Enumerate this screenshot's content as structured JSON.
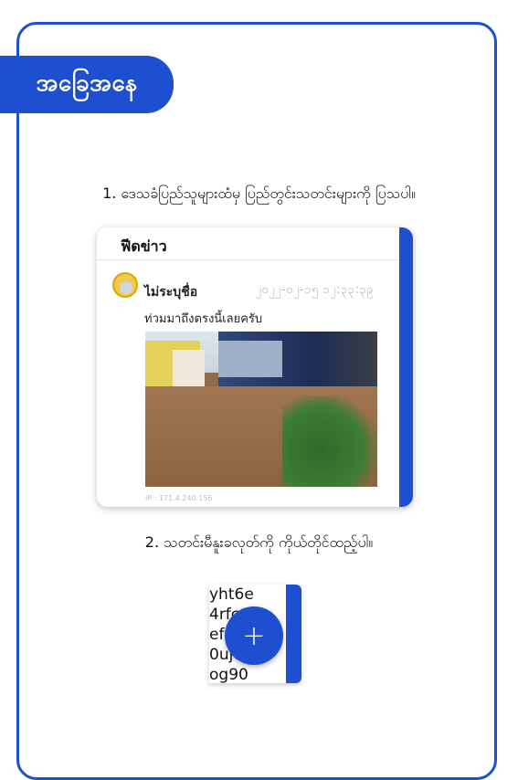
{
  "title": "အခြေအနေ",
  "step1": "1. ဒေသခံပြည်သူများထံမှ ပြည်တွင်းသတင်းများကို ပြသပါ။",
  "step2": "2. သတင်းမီနူးခလုတ်ကို ကိုယ်တိုင်ထည့်ပါ။",
  "feed": {
    "header": "ฟีดข่าว",
    "post": {
      "name": "ไม่ระบุชื่อ",
      "time": "၂၀၂၂-၀၂-၁၅ ၁၂:၃၃:၃၉",
      "text": "ท่วมมาถึงตรงนี้เลยครับ",
      "ip": "IP : 171.4.240.156"
    }
  },
  "menu": {
    "lines": [
      "yht6e",
      "4rfc",
      "ef",
      "0ujon",
      "og90"
    ],
    "fab_glyph": "+"
  },
  "colors": {
    "accent": "#1f4fd1"
  }
}
